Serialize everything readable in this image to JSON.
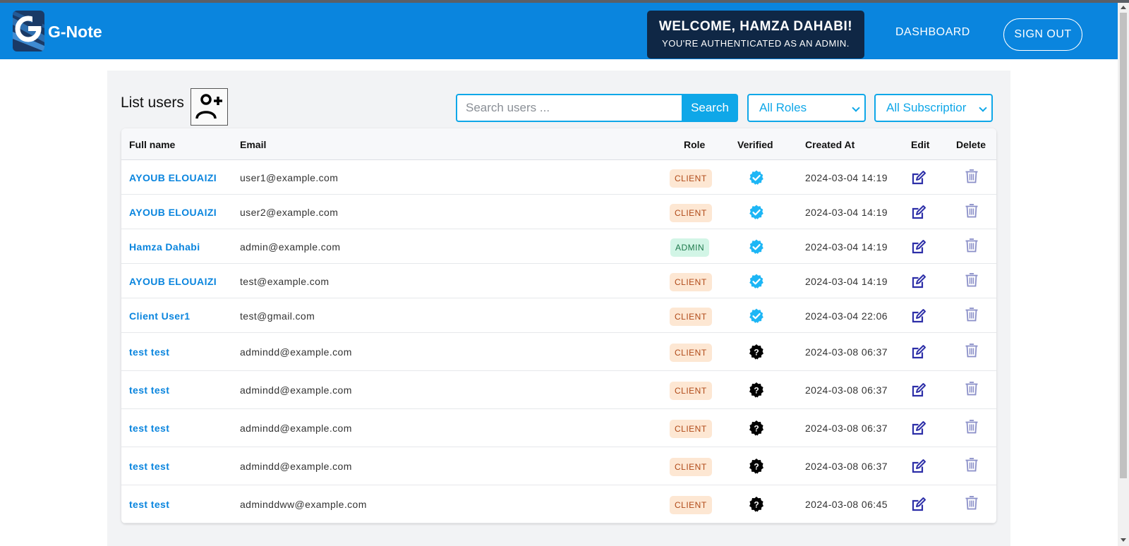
{
  "app": {
    "brand": "G-Note"
  },
  "header": {
    "welcome_title": "WELCOME, HAMZA DAHABI!",
    "welcome_subtitle": "YOU'RE AUTHENTICATED AS AN ADMIN.",
    "dashboard_label": "DASHBOARD",
    "signout_label": "SIGN OUT"
  },
  "page": {
    "title": "List users",
    "search_placeholder": "Search users ...",
    "search_value": "",
    "search_button": "Search",
    "role_filter": "All Roles",
    "subscription_filter": "All Subscriptior"
  },
  "table": {
    "columns": [
      "Full name",
      "Email",
      "Role",
      "Verified",
      "Created At",
      "Edit",
      "Delete"
    ],
    "rows": [
      {
        "name": "AYOUB ELOUAIZI",
        "email": "user1@example.com",
        "role": "CLIENT",
        "verified": true,
        "created": "2024-03-04 14:19"
      },
      {
        "name": "AYOUB ELOUAIZI",
        "email": "user2@example.com",
        "role": "CLIENT",
        "verified": true,
        "created": "2024-03-04 14:19"
      },
      {
        "name": "Hamza Dahabi",
        "email": "admin@example.com",
        "role": "ADMIN",
        "verified": true,
        "created": "2024-03-04 14:19"
      },
      {
        "name": "AYOUB ELOUAIZI",
        "email": "test@example.com",
        "role": "CLIENT",
        "verified": true,
        "created": "2024-03-04 14:19"
      },
      {
        "name": "Client User1",
        "email": "test@gmail.com",
        "role": "CLIENT",
        "verified": true,
        "created": "2024-03-04 22:06"
      },
      {
        "name": "test test",
        "email": "admindd@example.com",
        "role": "CLIENT",
        "verified": false,
        "created": "2024-03-08 06:37"
      },
      {
        "name": "test test",
        "email": "admindd@example.com",
        "role": "CLIENT",
        "verified": false,
        "created": "2024-03-08 06:37"
      },
      {
        "name": "test test",
        "email": "admindd@example.com",
        "role": "CLIENT",
        "verified": false,
        "created": "2024-03-08 06:37"
      },
      {
        "name": "test test",
        "email": "admindd@example.com",
        "role": "CLIENT",
        "verified": false,
        "created": "2024-03-08 06:37"
      },
      {
        "name": "test test",
        "email": "adminddww@example.com",
        "role": "CLIENT",
        "verified": false,
        "created": "2024-03-08 06:45"
      }
    ]
  },
  "icons": {
    "verified": "verified-badge-icon",
    "unverified": "unverified-question-icon",
    "edit": "edit-icon",
    "delete": "trash-icon",
    "add_user": "add-user-icon"
  },
  "colors": {
    "navbar": "#0a85de",
    "accent": "#0fa7e8",
    "verified": "#1db6f5",
    "edit": "#2d2fa8",
    "delete": "#8a8fc8"
  }
}
